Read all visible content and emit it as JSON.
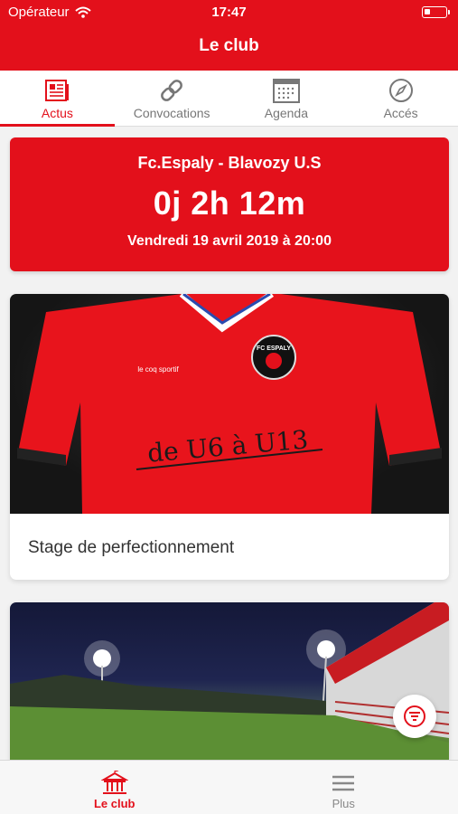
{
  "status": {
    "carrier": "Opérateur",
    "time": "17:47"
  },
  "nav": {
    "title": "Le club"
  },
  "tabs": [
    {
      "label": "Actus",
      "icon": "newspaper-icon"
    },
    {
      "label": "Convocations",
      "icon": "link-icon"
    },
    {
      "label": "Agenda",
      "icon": "calendar-icon"
    },
    {
      "label": "Accés",
      "icon": "compass-icon"
    }
  ],
  "match": {
    "teams": "Fc.Espaly - Blavozy U.S",
    "countdown": "0j 2h 12m",
    "date": "Vendredi 19 avril 2019 à 20:00"
  },
  "news": [
    {
      "title": "Stage de perfectionnement",
      "image_text": "de U6 à U13",
      "brand_text": "le coq sportif",
      "badge_text": "FC ESPALY"
    },
    {
      "title": "",
      "image_text": ""
    }
  ],
  "bottom": [
    {
      "label": "Le club",
      "icon": "club-building-icon"
    },
    {
      "label": "Plus",
      "icon": "menu-icon"
    }
  ],
  "colors": {
    "accent": "#e3101b",
    "inactive": "#777777"
  }
}
